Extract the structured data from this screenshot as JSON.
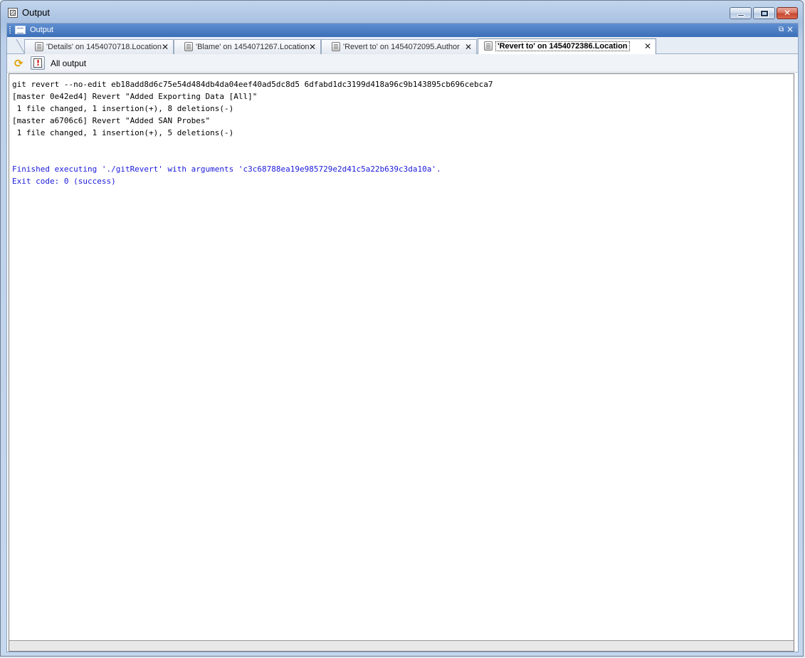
{
  "window": {
    "title": "Output"
  },
  "panel": {
    "title": "Output"
  },
  "tabs": [
    {
      "label": "'Details' on 1454070718.Location",
      "active": false
    },
    {
      "label": "'Blame' on 1454071267.Location",
      "active": false
    },
    {
      "label": "'Revert to' on 1454072095.Author",
      "active": false
    },
    {
      "label": "'Revert to' on 1454072386.Location",
      "active": true
    }
  ],
  "toolbar": {
    "filter_label": "All output"
  },
  "output": {
    "lines": [
      {
        "text": "git revert --no-edit eb18add8d6c75e54d484db4da04eef40ad5dc8d5 6dfabd1dc3199d418a96c9b143895cb696cebca7",
        "kind": "normal"
      },
      {
        "text": "[master 0e42ed4] Revert \"Added Exporting Data [All]\"",
        "kind": "normal"
      },
      {
        "text": " 1 file changed, 1 insertion(+), 8 deletions(-)",
        "kind": "normal"
      },
      {
        "text": "[master a6706c6] Revert \"Added SAN Probes\"",
        "kind": "normal"
      },
      {
        "text": " 1 file changed, 1 insertion(+), 5 deletions(-)",
        "kind": "normal"
      },
      {
        "text": "",
        "kind": "normal"
      },
      {
        "text": "",
        "kind": "normal"
      },
      {
        "text": "Finished executing './gitRevert' with arguments 'c3c68788ea19e985729e2d41c5a22b639c3da10a'.",
        "kind": "info"
      },
      {
        "text": "Exit code: 0 (success)",
        "kind": "info"
      }
    ]
  },
  "colors": {
    "info_text": "#1a1adb",
    "panel_header": "#4a7cc4"
  }
}
